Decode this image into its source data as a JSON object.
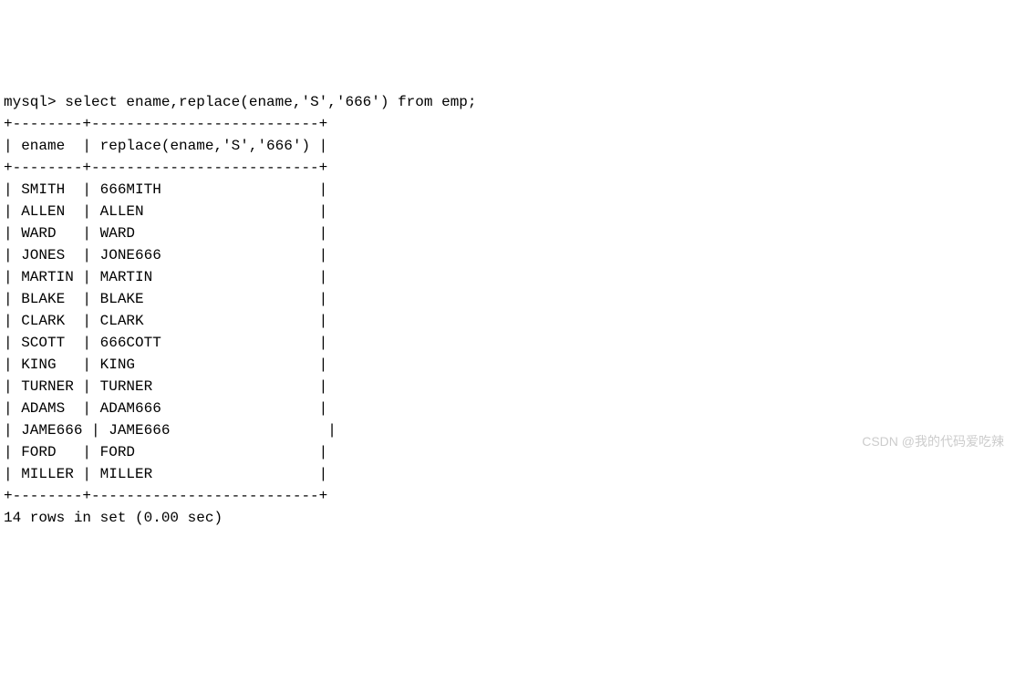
{
  "prompt": "mysql>",
  "query": "select ename,replace(ename,'S','666') from emp;",
  "separator": "+--------+--------------------------+",
  "header_col1": "ename",
  "header_col2": "replace(ename,'S','666')",
  "rows": [
    {
      "ename": "SMITH",
      "replaced": "666MITH"
    },
    {
      "ename": "ALLEN",
      "replaced": "ALLEN"
    },
    {
      "ename": "WARD",
      "replaced": "WARD"
    },
    {
      "ename": "JONES",
      "replaced": "JONE666"
    },
    {
      "ename": "MARTIN",
      "replaced": "MARTIN"
    },
    {
      "ename": "BLAKE",
      "replaced": "BLAKE"
    },
    {
      "ename": "CLARK",
      "replaced": "CLARK"
    },
    {
      "ename": "SCOTT",
      "replaced": "666COTT"
    },
    {
      "ename": "KING",
      "replaced": "KING"
    },
    {
      "ename": "TURNER",
      "replaced": "TURNER"
    },
    {
      "ename": "ADAMS",
      "replaced": "ADAM666"
    },
    {
      "ename": "JAME666",
      "replaced": "JAME666"
    },
    {
      "ename": "FORD",
      "replaced": "FORD"
    },
    {
      "ename": "MILLER",
      "replaced": "MILLER"
    }
  ],
  "footer": "14 rows in set (0.00 sec)",
  "watermark": "CSDN @我的代码爱吃辣"
}
